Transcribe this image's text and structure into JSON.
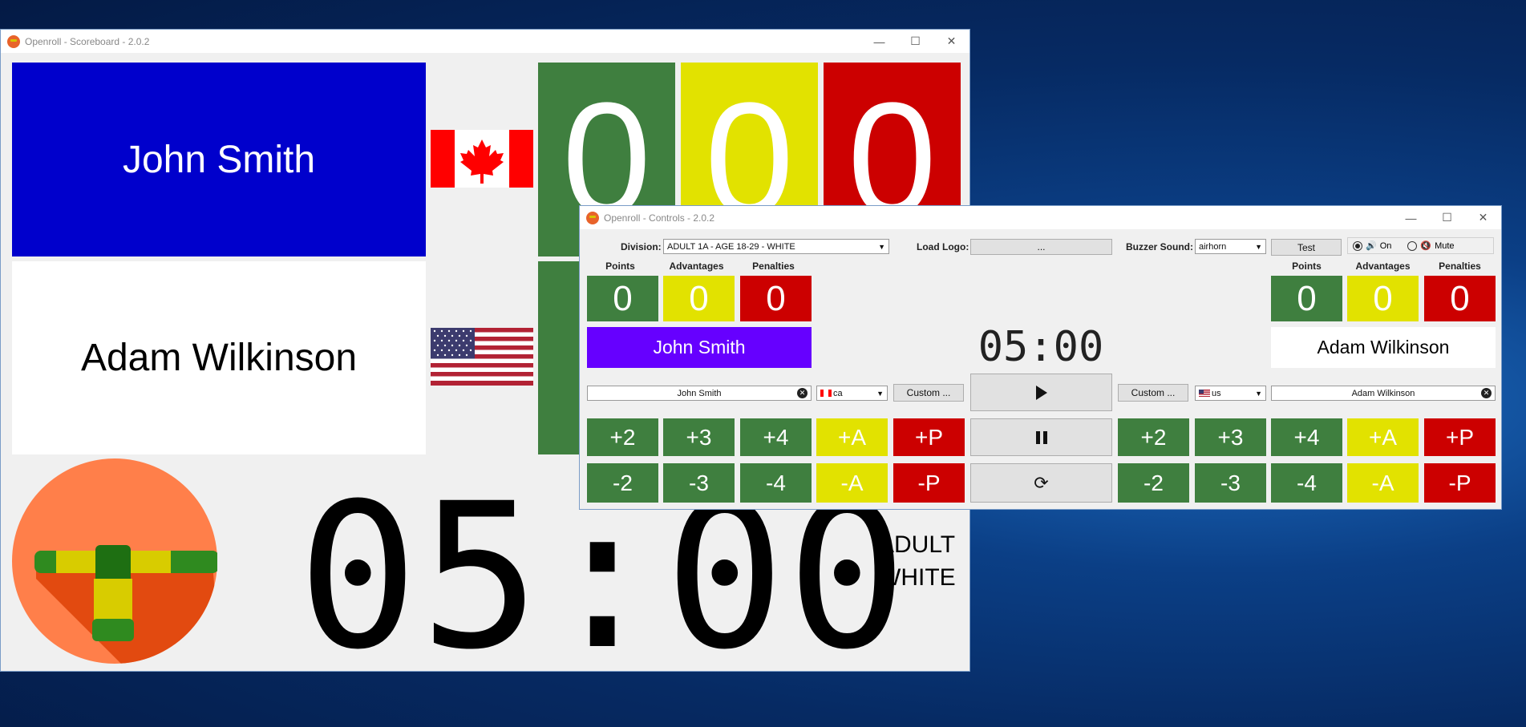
{
  "scoreboard": {
    "title": "Openroll - Scoreboard - 2.0.2",
    "competitor1": {
      "name": "John Smith",
      "flag": "ca",
      "points": "0",
      "advantages": "0",
      "penalties": "0"
    },
    "competitor2": {
      "name": "Adam Wilkinson",
      "flag": "us"
    },
    "timer": "05:00",
    "division_line1": "ADULT",
    "division_line2": "WHITE",
    "colors": {
      "blue": "#0000cc",
      "green": "#3f7f3f",
      "yellow": "#e2e200",
      "red": "#cc0000"
    }
  },
  "controls": {
    "title": "Openroll - Controls - 2.0.2",
    "division_label": "Division:",
    "division_value": "ADULT 1A - AGE 18-29 - WHITE",
    "load_logo_label": "Load Logo:",
    "load_logo_button": "...",
    "buzzer_label": "Buzzer Sound:",
    "buzzer_value": "airhorn",
    "test_button": "Test",
    "sound_on": "On",
    "sound_mute": "Mute",
    "headers": {
      "points": "Points",
      "advantages": "Advantages",
      "penalties": "Penalties"
    },
    "left": {
      "points": "0",
      "advantages": "0",
      "penalties": "0",
      "name": "John Smith",
      "name_field": "John Smith",
      "flag": "ca",
      "custom": "Custom ..."
    },
    "right": {
      "points": "0",
      "advantages": "0",
      "penalties": "0",
      "name": "Adam Wilkinson",
      "name_field": "Adam Wilkinson",
      "flag": "us",
      "custom": "Custom ..."
    },
    "timer": "05:00",
    "plus": [
      "+2",
      "+3",
      "+4",
      "+A",
      "+P"
    ],
    "minus": [
      "-2",
      "-3",
      "-4",
      "-A",
      "-P"
    ]
  }
}
